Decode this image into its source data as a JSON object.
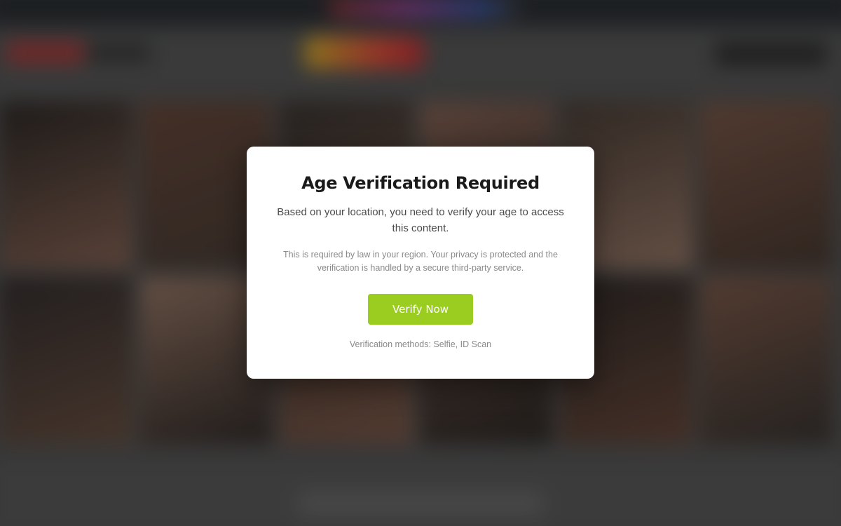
{
  "background": {
    "tile_colors": [
      "#1f1a18",
      "#5a3a2c",
      "#2a2522",
      "#7a5646",
      "#3b2f28",
      "#6d4a3a",
      "#262020",
      "#8a6a58",
      "#3a2a22",
      "#5c4234",
      "#231c1a",
      "#704c3c"
    ],
    "accent_colors": {
      "topbar": "#1d2126",
      "brand_red": "#a02d2d",
      "brand_gold": "#c9a21c"
    }
  },
  "modal": {
    "title": "Age Verification Required",
    "description": "Based on your location, you need to verify your age to access this content.",
    "note": "This is required by law in your region. Your privacy is protected and the verification is handled by a secure third-party service.",
    "verify_button_label": "Verify Now",
    "methods_text": "Verification methods: Selfie, ID Scan",
    "button_color": "#9acd1f"
  }
}
